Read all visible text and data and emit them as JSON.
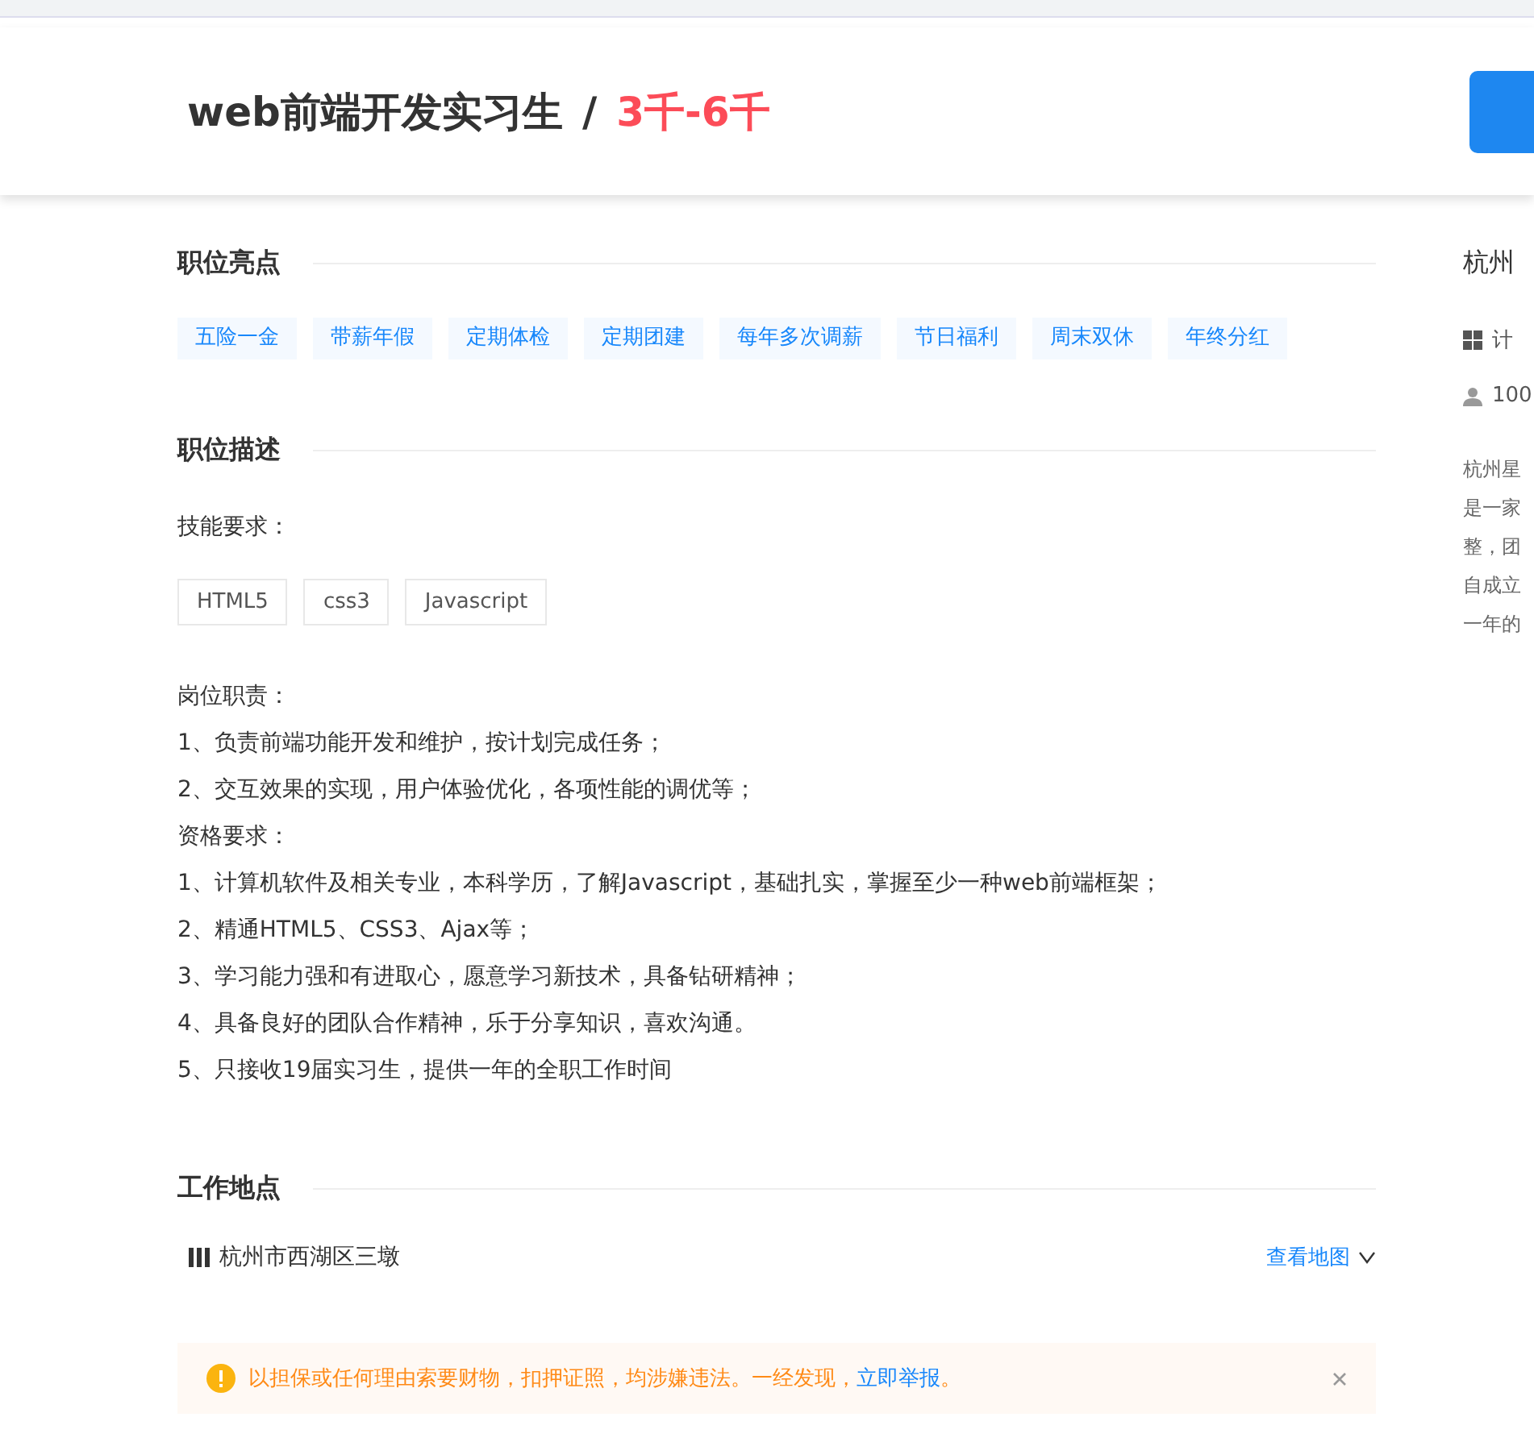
{
  "header": {
    "title": "web前端开发实习生",
    "separator": "/",
    "salary": "3千-6千"
  },
  "highlights": {
    "heading": "职位亮点",
    "tags": [
      "五险一金",
      "带薪年假",
      "定期体检",
      "定期团建",
      "每年多次调薪",
      "节日福利",
      "周末双休",
      "年终分红"
    ]
  },
  "description": {
    "heading": "职位描述",
    "skills_label": "技能要求：",
    "skills": [
      "HTML5",
      "css3",
      "Javascript"
    ],
    "lines": [
      "岗位职责：",
      "1、负责前端功能开发和维护，按计划完成任务；",
      "2、交互效果的实现，用户体验优化，各项性能的调优等；",
      "资格要求：",
      "1、计算机软件及相关专业，本科学历，了解Javascript，基础扎实，掌握至少一种web前端框架；",
      "2、精通HTML5、CSS3、Ajax等；",
      "3、学习能力强和有进取心，愿意学习新技术，具备钻研精神；",
      "4、具备良好的团队合作精神，乐于分享知识，喜欢沟通。",
      "5、只接收19届实习生，提供一年的全职工作时间"
    ]
  },
  "location": {
    "heading": "工作地点",
    "address": "杭州市西湖区三墩",
    "map_link": "查看地图"
  },
  "notice": {
    "text": "以担保或任何理由索要财物，扣押证照，均涉嫌违法。一经发现，",
    "link": "立即举报",
    "end": "。"
  },
  "company": {
    "name": "杭州",
    "industry": "计",
    "size": "100",
    "intro_lines": [
      "杭州星",
      "是一家",
      "整，团",
      "自成立",
      "一年的"
    ]
  }
}
